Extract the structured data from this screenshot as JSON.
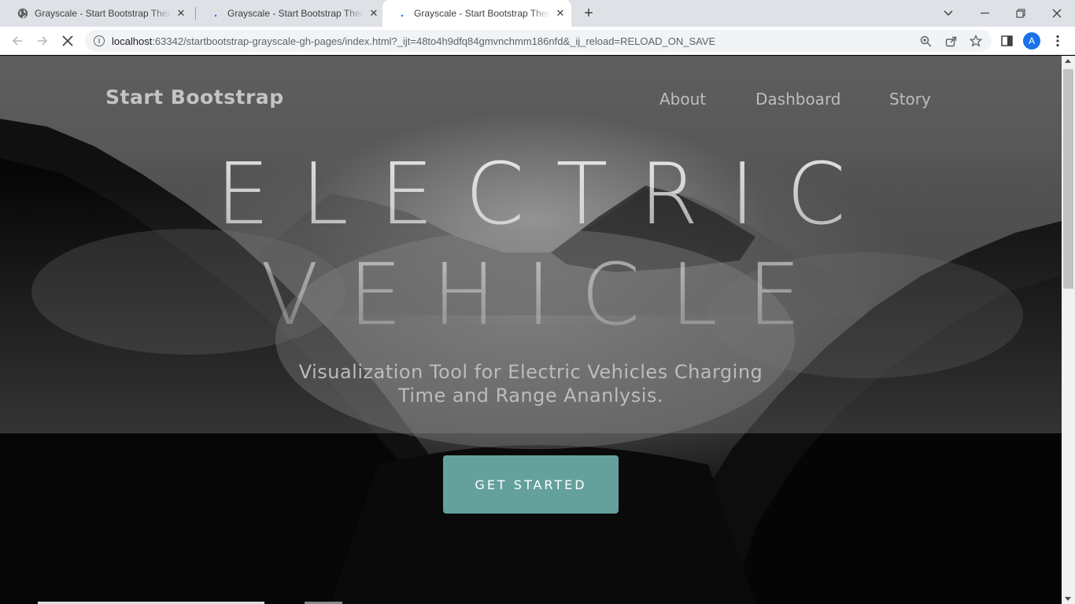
{
  "browser": {
    "tabs": [
      {
        "title": "Grayscale - Start Bootstrap Theme",
        "favicon": "globe-icon",
        "active": false
      },
      {
        "title": "Grayscale - Start Bootstrap Theme",
        "favicon": "loading-dot-icon",
        "active": false
      },
      {
        "title": "Grayscale - Start Bootstrap Theme",
        "favicon": "loading-dot-icon",
        "active": true
      }
    ],
    "url_host": "localhost",
    "url_rest": ":63342/startbootstrap-grayscale-gh-pages/index.html?_ijt=48to4h9dfq84gmvnchmm186nfd&_ij_reload=RELOAD_ON_SAVE",
    "profile_initial": "A"
  },
  "page": {
    "brand": "Start Bootstrap",
    "nav": [
      "About",
      "Dashboard",
      "Story"
    ],
    "hero_line1": "ELECTRIC",
    "hero_line2": "VEHICLE",
    "subtitle_line1": "Visualization Tool for Electric Vehicles Charging",
    "subtitle_line2": "Time and Range Ananlysis.",
    "cta_label": "GET STARTED",
    "accent_color": "#64a19d"
  }
}
